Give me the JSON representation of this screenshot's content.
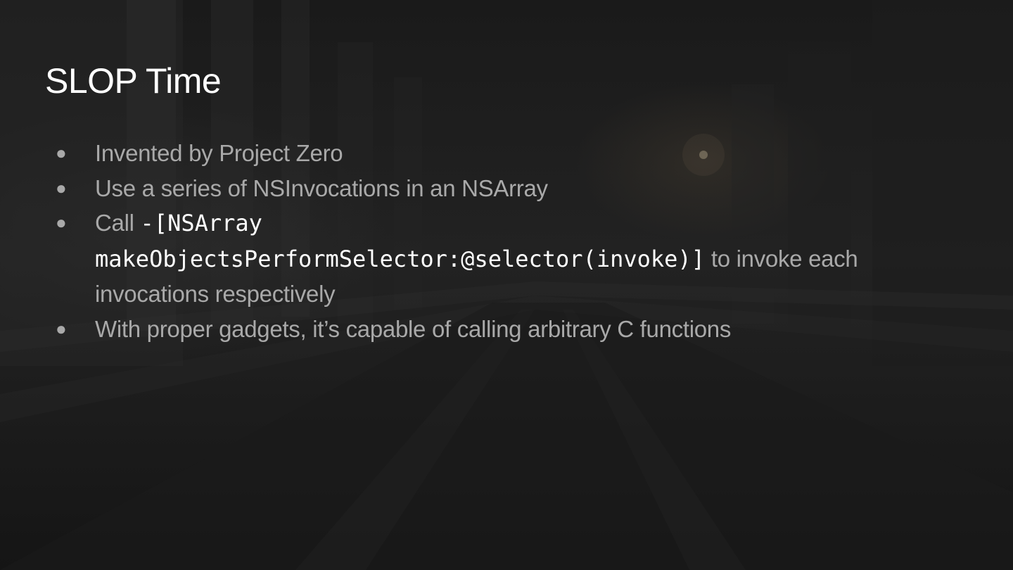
{
  "slide": {
    "title": "SLOP Time",
    "bullet_marker": "●",
    "bullets": [
      {
        "text": "Invented by Project Zero"
      },
      {
        "text": "Use a series of NSInvocations in an NSArray"
      },
      {
        "prefix": "Call ",
        "code_line1": "-[NSArray",
        "code_line2": "makeObjectsPerformSelector:@selector(invoke)]",
        "suffix": " to invoke each invocations respectively"
      },
      {
        "text": "With proper gadgets, it’s capable of calling arbitrary C functions"
      }
    ]
  }
}
